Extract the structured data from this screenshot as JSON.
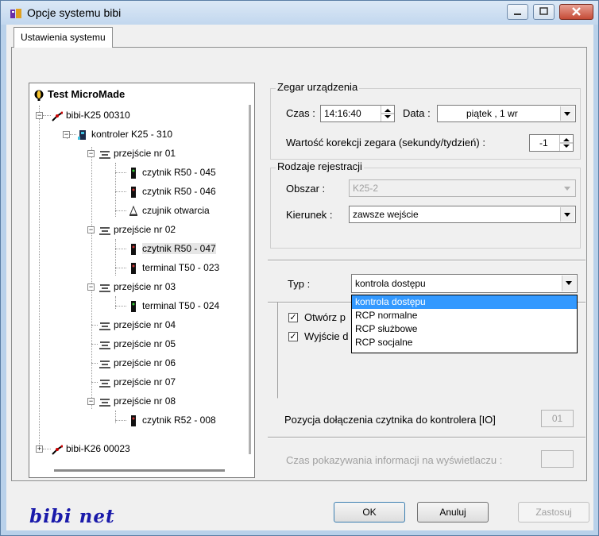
{
  "window": {
    "title": "Opcje systemu bibi"
  },
  "tabs": [
    {
      "label": "Ustawienia systemu"
    }
  ],
  "tree": {
    "root": "Test MicroMade",
    "nodes": [
      {
        "label": "bibi-K25 00310"
      },
      {
        "label": "kontroler K25 - 310"
      },
      {
        "label": "przejście nr 01"
      },
      {
        "label": "czytnik R50 - 045"
      },
      {
        "label": "czytnik R50 - 046"
      },
      {
        "label": "czujnik otwarcia"
      },
      {
        "label": "przejście nr 02"
      },
      {
        "label": "czytnik R50 - 047"
      },
      {
        "label": "terminal T50 - 023"
      },
      {
        "label": "przejście nr 03"
      },
      {
        "label": "terminal T50 - 024"
      },
      {
        "label": "przejście nr 04"
      },
      {
        "label": "przejście nr 05"
      },
      {
        "label": "przejście nr 06"
      },
      {
        "label": "przejście nr 07"
      },
      {
        "label": "przejście nr 08"
      },
      {
        "label": "czytnik R52 - 008"
      },
      {
        "label": "bibi-K26 00023"
      }
    ]
  },
  "clock": {
    "group_label": "Zegar urządzenia",
    "time_label": "Czas :",
    "time_value": "14:16:40",
    "date_label": "Data :",
    "date_value": "piątek    ,  1   wr",
    "correction_label": "Wartość korekcji zegara (sekundy/tydzień) :",
    "correction_value": "-1"
  },
  "registration": {
    "group_label": "Rodzaje rejestracji",
    "area_label": "Obszar :",
    "area_value": "K25-2",
    "direction_label": "Kierunek :",
    "direction_value": "zawsze wejście"
  },
  "type": {
    "label": "Typ :",
    "value": "kontrola dostępu",
    "options": [
      "kontrola dostępu",
      "RCP normalne",
      "RCP służbowe",
      "RCP socjalne"
    ],
    "selected_index": 0
  },
  "checkboxes": [
    {
      "label": "Otwórz p",
      "checked": true
    },
    {
      "label": "Wyjście d",
      "checked": true
    }
  ],
  "reader_position": {
    "label": "Pozycja dołączenia czytnika do kontrolera [IO]",
    "value": "01"
  },
  "display_time": {
    "label": "Czas pokazywania informacji na wyświetlaczu :",
    "value": ""
  },
  "logo": "bibi net",
  "buttons": {
    "ok": "OK",
    "cancel": "Anuluj",
    "apply": "Zastosuj"
  },
  "colors": {
    "selection": "#3399ff",
    "logo": "#1a1aaa",
    "close": "#c54b36"
  }
}
